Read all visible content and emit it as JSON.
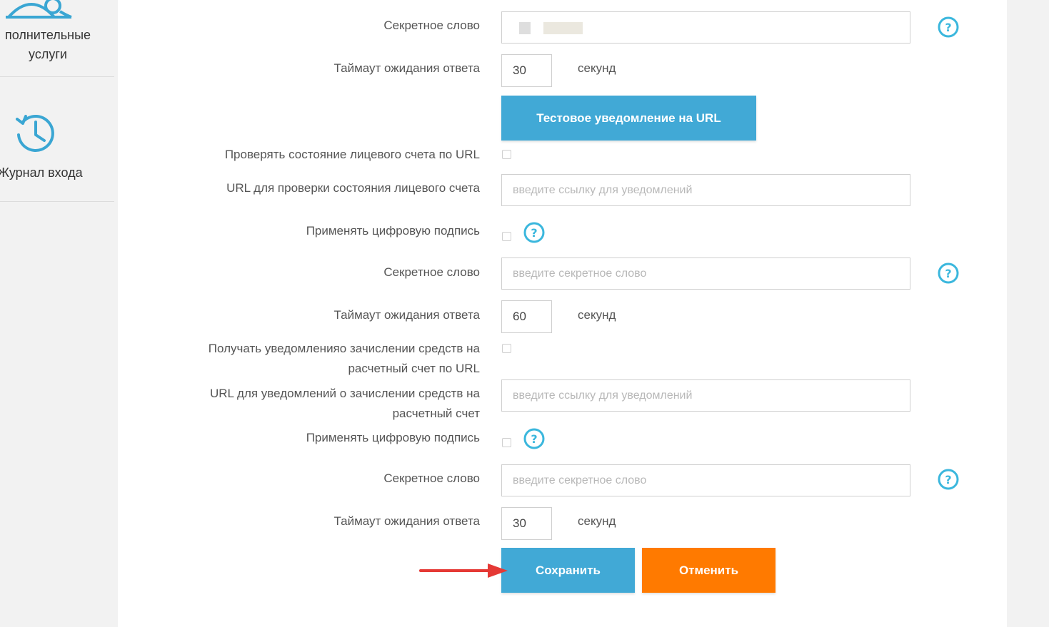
{
  "sidebar": {
    "items": [
      {
        "label_line1": "полнительные",
        "label_line2": "услуги",
        "icon": "services-icon"
      },
      {
        "label": "Журнал входа",
        "icon": "history-icon"
      }
    ]
  },
  "form": {
    "rows": [
      {
        "label": "Секретное слово"
      },
      {
        "label": "Таймаут ожидания ответа",
        "value": "30",
        "unit": "секунд"
      },
      {
        "button": "Тестовое уведомление на URL"
      },
      {
        "label": "Проверять состояние лицевого счета по URL"
      },
      {
        "label": "URL для проверки состояния лицевого счета",
        "placeholder": "введите ссылку для уведомлений"
      },
      {
        "label": "Применять цифровую подпись"
      },
      {
        "label": "Секретное слово",
        "placeholder": "введите секретное слово"
      },
      {
        "label": "Таймаут ожидания ответа",
        "value": "60",
        "unit": "секунд"
      },
      {
        "label_line1": "Получать уведомленияо зачислении средств на",
        "label_line2": "расчетный счет по URL"
      },
      {
        "label_line1": "URL для уведомлений о зачислении средств на",
        "label_line2": "расчетный счет",
        "placeholder": "введите ссылку для уведомлений"
      },
      {
        "label": "Применять цифровую подпись"
      },
      {
        "label": "Секретное слово",
        "placeholder": "введите секретное слово"
      },
      {
        "label": "Таймаут ожидания ответа",
        "value": "30",
        "unit": "секунд"
      }
    ]
  },
  "actions": {
    "save_label": "Сохранить",
    "cancel_label": "Отменить"
  },
  "colors": {
    "accent_blue": "#41a9d6",
    "accent_orange": "#ff7a00",
    "help_icon": "#3bb7dd",
    "arrow": "#e53935"
  }
}
